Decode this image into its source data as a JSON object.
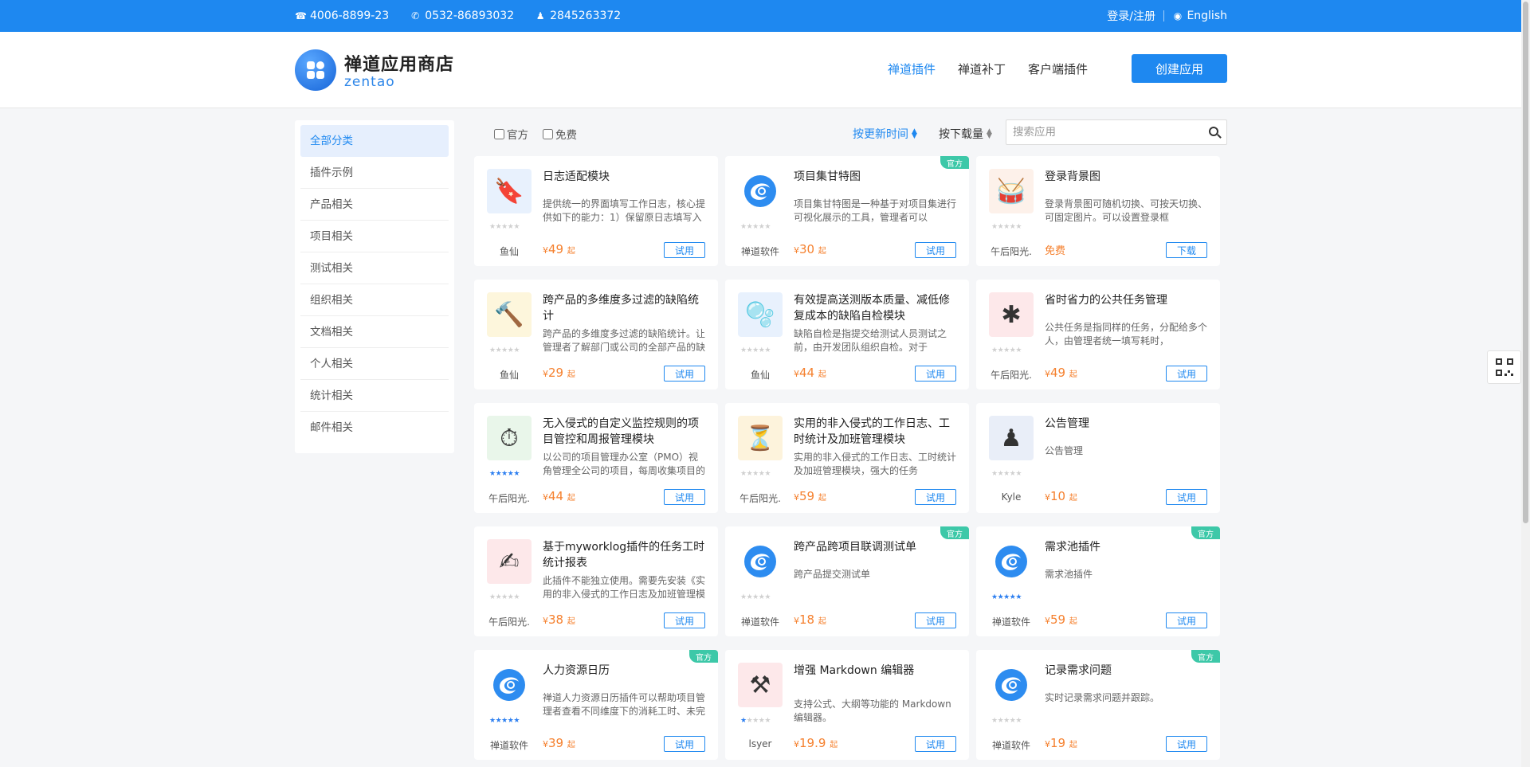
{
  "topbar": {
    "phone1": "4006-8899-23",
    "phone2": "0532-86893032",
    "qq": "2845263372",
    "login": "登录/注册",
    "language": "English"
  },
  "header": {
    "logo_cn": "禅道应用商店",
    "logo_en": "zentao",
    "nav": [
      "禅道插件",
      "禅道补丁",
      "客户端插件"
    ],
    "create_button": "创建应用"
  },
  "sidebar": {
    "items": [
      "全部分类",
      "插件示例",
      "产品相关",
      "项目相关",
      "测试相关",
      "组织相关",
      "文档相关",
      "个人相关",
      "统计相关",
      "邮件相关"
    ]
  },
  "filters": {
    "official": "官方",
    "free": "免费",
    "sort_updated": "按更新时间",
    "sort_downloads": "按下载量",
    "search_placeholder": "搜索应用"
  },
  "ribbon_label": "官方",
  "cards": [
    {
      "title": "日志适配模块",
      "desc": "提供统一的界面填写工作日志，核心提供如下的能力：1）保留原日志填写入口",
      "author": "鱼仙",
      "price": "49",
      "free": false,
      "button": "试用",
      "official": false,
      "stars": 0,
      "icon": "bookmark-icon"
    },
    {
      "title": "项目集甘特图",
      "desc": "项目集甘特图是一种基于对项目集进行可视化展示的工具，管理者可以",
      "author": "禅道软件",
      "price": "30",
      "free": false,
      "button": "试用",
      "official": true,
      "stars": 0,
      "icon": "zentao-icon"
    },
    {
      "title": "登录背景图",
      "desc": "登录背景图可随机切换、可按天切换、可固定图片。可以设置登录框",
      "author": "午后阳光.",
      "price": "免费",
      "free": true,
      "button": "下载",
      "official": false,
      "stars": 0,
      "icon": "drum-icon"
    },
    {
      "title": "跨产品的多维度多过滤的缺陷统计",
      "desc": "跨产品的多维度多过滤的缺陷统计。让管理者了解部门或公司的全部产品的缺陷",
      "author": "鱼仙",
      "price": "29",
      "free": false,
      "button": "试用",
      "official": false,
      "stars": 0,
      "icon": "hammer-icon"
    },
    {
      "title": "有效提高送测版本质量、减低修复成本的缺陷自检模块",
      "desc": "缺陷自检是指提交给测试人员测试之前，由开发团队组织自检。对于",
      "author": "鱼仙",
      "price": "44",
      "free": false,
      "button": "试用",
      "official": false,
      "stars": 0,
      "icon": "bubbles-icon"
    },
    {
      "title": "省时省力的公共任务管理",
      "desc": "公共任务是指同样的任务，分配给多个人，由管理者统一填写耗时，",
      "author": "午后阳光.",
      "price": "49",
      "free": false,
      "button": "试用",
      "official": false,
      "stars": 0,
      "icon": "asterisk-icon"
    },
    {
      "title": "无入侵式的自定义监控规则的项目管控和周报管理模块",
      "desc": "以公司的项目管理办公室（PMO）视角管理全公司的项目，每周收集项目的",
      "author": "午后阳光.",
      "price": "44",
      "free": false,
      "button": "试用",
      "official": false,
      "stars": 5,
      "icon": "stopwatch-icon"
    },
    {
      "title": "实用的非入侵式的工作日志、工时统计及加班管理模块",
      "desc": "实用的非入侵式的工作日志、工时统计及加班管理模块，强大的任务",
      "author": "午后阳光.",
      "price": "59",
      "free": false,
      "button": "试用",
      "official": false,
      "stars": 0,
      "icon": "hourglass-icon"
    },
    {
      "title": "公告管理",
      "desc": "公告管理",
      "author": "Kyle",
      "price": "10",
      "free": false,
      "button": "试用",
      "official": false,
      "stars": 0,
      "icon": "pawn-icon"
    },
    {
      "title": "基于myworklog插件的任务工时统计报表",
      "desc": "此插件不能独立使用。需要先安装《实用的非入侵式的工作日志及加班管理模",
      "author": "午后阳光.",
      "price": "38",
      "free": false,
      "button": "试用",
      "official": false,
      "stars": 0,
      "icon": "pen-icon"
    },
    {
      "title": "跨产品跨项目联调测试单",
      "desc": "跨产品提交测试单",
      "author": "禅道软件",
      "price": "18",
      "free": false,
      "button": "试用",
      "official": true,
      "stars": 0,
      "icon": "zentao-icon"
    },
    {
      "title": "需求池插件",
      "desc": "需求池插件",
      "author": "禅道软件",
      "price": "59",
      "free": false,
      "button": "试用",
      "official": true,
      "stars": 5,
      "icon": "zentao-icon"
    },
    {
      "title": "人力资源日历",
      "desc": "禅道人力资源日历插件可以帮助项目管理者查看不同维度下的消耗工时、未完",
      "author": "禅道软件",
      "price": "39",
      "free": false,
      "button": "试用",
      "official": true,
      "stars": 5,
      "icon": "zentao-icon"
    },
    {
      "title": "增强 Markdown 编辑器",
      "desc": "支持公式、大纲等功能的 Markdown 编辑器。",
      "author": "lsyer",
      "price": "19.9",
      "free": false,
      "button": "试用",
      "official": false,
      "stars": 1,
      "icon": "tools-icon"
    },
    {
      "title": "记录需求问题",
      "desc": "实时记录需求问题并跟踪。",
      "author": "禅道软件",
      "price": "19",
      "free": false,
      "button": "试用",
      "official": true,
      "stars": 0,
      "icon": "zentao-icon"
    }
  ],
  "price_prefix": "¥",
  "price_suffix": "起"
}
